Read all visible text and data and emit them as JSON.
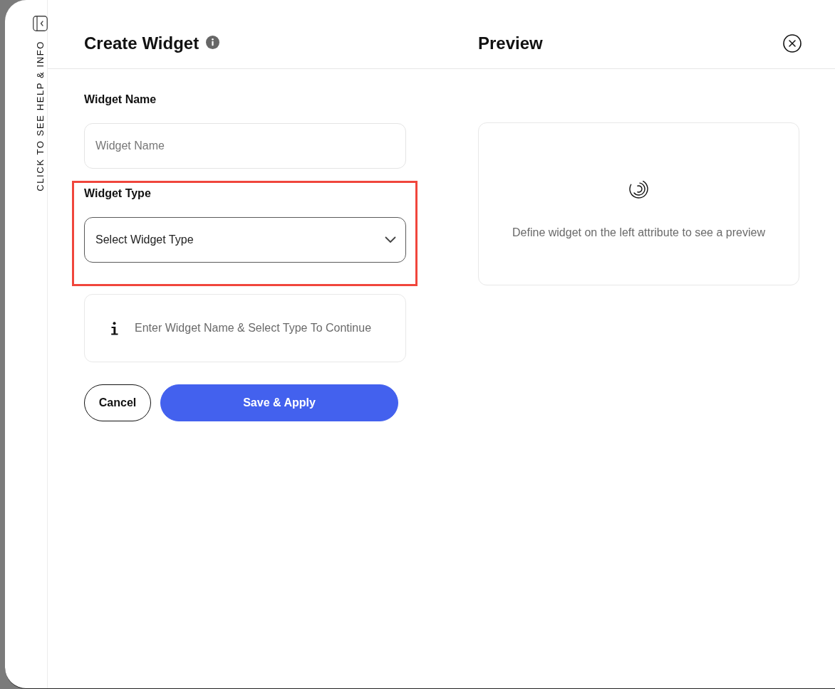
{
  "help_rail": {
    "label": "CLICK TO SEE HELP & INFO"
  },
  "form": {
    "title": "Create Widget",
    "fields": [
      {
        "kind": "text",
        "label": "Widget Name",
        "placeholder": "Widget Name",
        "highlighted": false
      },
      {
        "kind": "select",
        "label": "Widget Type",
        "placeholder": "Select Widget Type",
        "highlighted": true
      }
    ],
    "notice": "Enter Widget Name & Select Type To Continue",
    "buttons": [
      {
        "kind": "secondary",
        "label": "Cancel"
      },
      {
        "kind": "primary",
        "label": "Save & Apply"
      }
    ]
  },
  "preview": {
    "title": "Preview",
    "message": "Define widget on the left attribute to see a preview"
  }
}
